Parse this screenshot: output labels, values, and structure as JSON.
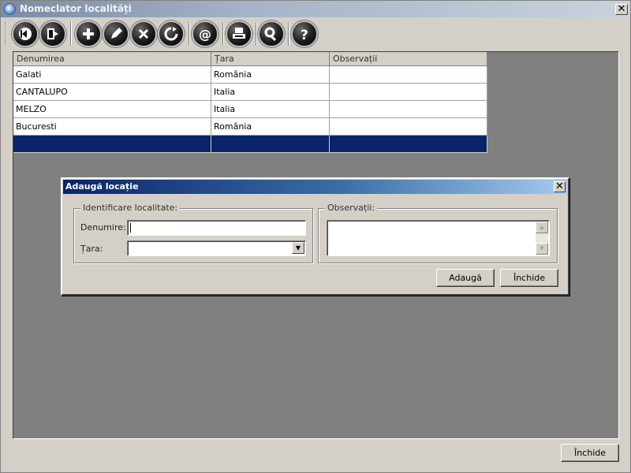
{
  "window": {
    "title": "Nomeclator localități",
    "close_label": "✕"
  },
  "toolbar": {
    "buttons": [
      {
        "name": "first-icon"
      },
      {
        "name": "exit-icon"
      },
      {
        "name": "add-icon"
      },
      {
        "name": "edit-icon"
      },
      {
        "name": "delete-icon"
      },
      {
        "name": "refresh-icon"
      },
      {
        "name": "email-icon"
      },
      {
        "name": "print-icon"
      },
      {
        "name": "search-icon"
      },
      {
        "name": "help-icon"
      }
    ]
  },
  "grid": {
    "columns": [
      "Denumirea",
      "Țara",
      "Observații"
    ],
    "rows": [
      [
        "Galati",
        "România",
        ""
      ],
      [
        "CANTALUPO",
        "Italia",
        ""
      ],
      [
        "MELZO",
        "Italia",
        ""
      ],
      [
        "Bucuresti",
        "România",
        ""
      ]
    ]
  },
  "dialog": {
    "title": "Adaugă locație",
    "close_label": "✕",
    "group_location": "Identificare localitate:",
    "name_label": "Denumire:",
    "name_value": "",
    "country_label": "Țara:",
    "country_value": "",
    "group_notes": "Observații:",
    "notes_value": "",
    "add_button": "Adaugă",
    "close_button": "Închide"
  },
  "footer": {
    "close_button": "Închide"
  },
  "colors": {
    "selection": "#0a246a",
    "content_bg": "#808080"
  }
}
